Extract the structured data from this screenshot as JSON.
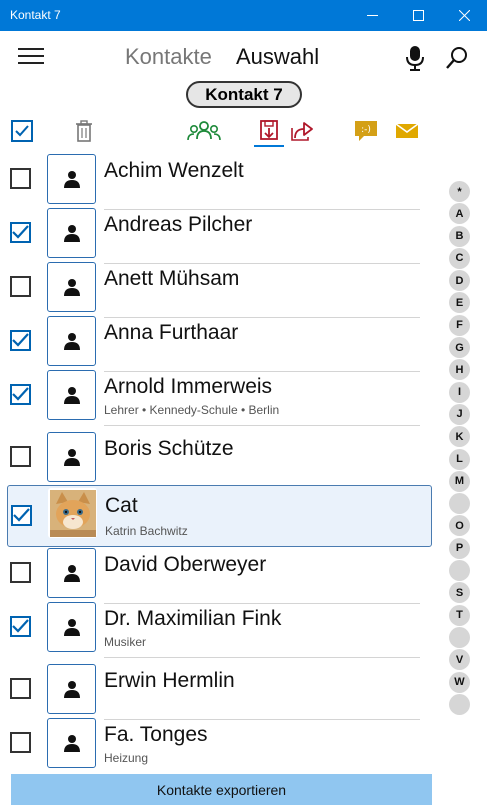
{
  "window": {
    "title": "Kontakt 7"
  },
  "header": {
    "tabs": [
      {
        "label": "Kontakte",
        "active": false
      },
      {
        "label": "Auswahl",
        "active": true
      }
    ],
    "pill_label": "Kontakt 7"
  },
  "toolbar": {
    "icons": [
      "select-all-checkbox-icon",
      "trash-icon",
      "groups-icon",
      "save-download-icon",
      "share-icon",
      "sms-icon",
      "mail-icon"
    ]
  },
  "contacts": [
    {
      "name": "Achim Wenzelt",
      "sub": "",
      "checked": false
    },
    {
      "name": "Andreas Pilcher",
      "sub": "",
      "checked": true
    },
    {
      "name": "Anett Mühsam",
      "sub": "",
      "checked": false
    },
    {
      "name": "Anna Furthaar",
      "sub": "",
      "checked": true
    },
    {
      "name": "Arnold Immerweis",
      "sub": "Lehrer • Kennedy-Schule • Berlin",
      "checked": true
    },
    {
      "name": "Boris Schütze",
      "sub": "",
      "checked": false
    },
    {
      "name": "Cat",
      "sub": "Katrin Bachwitz",
      "checked": true,
      "photo": true,
      "selected": true
    },
    {
      "name": "David Oberweyer",
      "sub": "",
      "checked": false
    },
    {
      "name": "Dr. Maximilian Fink",
      "sub": "Musiker",
      "checked": true
    },
    {
      "name": "Erwin Hermlin",
      "sub": "",
      "checked": false
    },
    {
      "name": "Fa. Tonges",
      "sub": "Heizung",
      "checked": false
    }
  ],
  "index_letters": [
    "*",
    "A",
    "B",
    "C",
    "D",
    "E",
    "F",
    "G",
    "H",
    "I",
    "J",
    "K",
    "L",
    "M",
    "",
    "O",
    "P",
    "",
    "S",
    "T",
    "",
    "V",
    "W",
    ""
  ],
  "export_label": "Kontakte exportieren",
  "colors": {
    "accent": "#0078d7",
    "export_bar": "#90c6f0",
    "green_icon": "#1e8a3a",
    "red_icon": "#b0182b",
    "yellow_icon": "#e0a800"
  }
}
